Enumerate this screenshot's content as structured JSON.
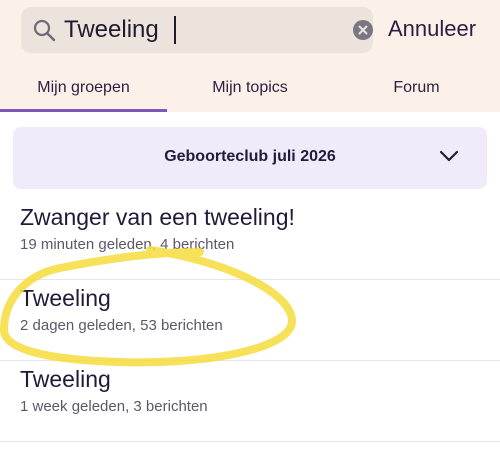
{
  "search": {
    "value": "Tweeling",
    "cancel_label": "Annuleer"
  },
  "tabs": [
    {
      "label": "Mijn groepen",
      "active": true
    },
    {
      "label": "Mijn topics",
      "active": false
    },
    {
      "label": "Forum",
      "active": false
    }
  ],
  "group_selector": {
    "label": "Geboorteclub juli 2026"
  },
  "topics": [
    {
      "title": "Zwanger van een tweeling!",
      "meta": "19 minuten geleden, 4 berichten"
    },
    {
      "title": "Tweeling",
      "meta": "2 dagen geleden, 53 berichten"
    },
    {
      "title": "Tweeling",
      "meta": "1 week geleden, 3 berichten"
    }
  ],
  "colors": {
    "header_bg": "#fcf1e8",
    "accent": "#7e58b8",
    "selector_bg": "#efebfb",
    "highlighter": "#f5dc3c"
  }
}
